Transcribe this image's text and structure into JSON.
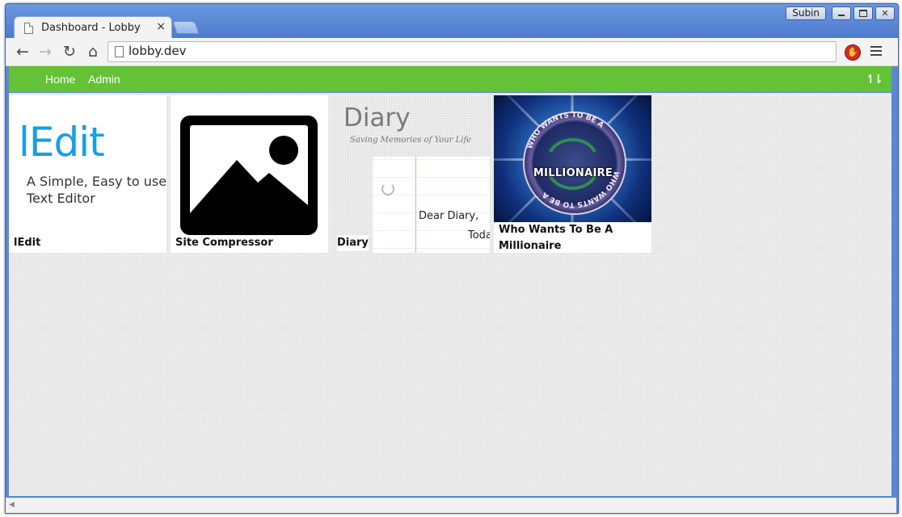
{
  "window": {
    "user": "Subin",
    "controls": {
      "minimize": "–",
      "maximize": "□",
      "close": "✕"
    }
  },
  "tab": {
    "title": "Dashboard - Lobby",
    "close": "×"
  },
  "toolbar": {
    "url": "lobby.dev",
    "back": "←",
    "forward": "→",
    "reload": "↻",
    "home": "⌂"
  },
  "nav": {
    "links": [
      "Home",
      "Admin"
    ],
    "sort_icon": "↿⇂"
  },
  "apps": [
    {
      "name": "lEdit",
      "logo": "lEdit",
      "tagline": "A Simple, Easy to use Text Editor"
    },
    {
      "name": "Site Compressor",
      "icon": "image-placeholder-icon"
    },
    {
      "name": "Diary",
      "title": "Diary",
      "subtitle": "Saving Memories of Your Life",
      "paper_line1": "Dear Diary,",
      "paper_line2": "Toda"
    },
    {
      "name": "Who Wants To Be A Millionaire",
      "logo_main": "MILLIONAIRE",
      "logo_ring": "WHO WANTS TO BE A"
    }
  ],
  "colors": {
    "nav_bg": "#63c235",
    "accent_blue": "#1a9de6",
    "window_blue": "#5b87d3"
  }
}
